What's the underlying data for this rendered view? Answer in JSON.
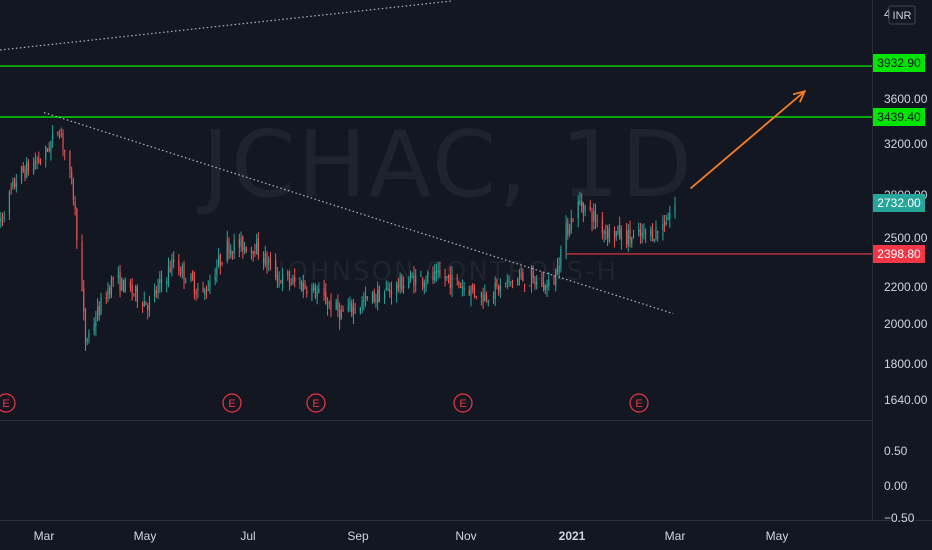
{
  "watermark": {
    "symbol": "JCHAC, 1D",
    "name": "JOHNSON CONTROLS-H"
  },
  "currency": "INR",
  "colors": {
    "background": "#131722",
    "up": "#26a69a",
    "down": "#ef5350",
    "green_line": "#00ff00",
    "red_line": "#f23645",
    "arrow": "#f57c27",
    "trend": "#b2b5be",
    "earnings": "#f23645"
  },
  "price_labels": [
    {
      "text": "3932.90",
      "value": 3932.9,
      "color": "#00e600"
    },
    {
      "text": "3439.40",
      "value": 3439.4,
      "color": "#00e600"
    },
    {
      "text": "2732.00",
      "value": 2732.0,
      "color": "#26a69a"
    },
    {
      "text": "2398.80",
      "value": 2398.8,
      "color": "#f23645"
    }
  ],
  "y_ticks": [
    "4",
    "3600.00",
    "3200.00",
    "2800.00",
    "2500.00",
    "2200.00",
    "2000.00",
    "1800.00",
    "1640.00"
  ],
  "indicator_ticks": [
    "0.50",
    "0.00",
    "−0.50"
  ],
  "x_ticks": [
    "Mar",
    "May",
    "Jul",
    "Sep",
    "Nov",
    "2021",
    "Mar",
    "May"
  ],
  "earnings_markers": [
    "E",
    "E",
    "E",
    "E",
    "E"
  ],
  "chart_data": {
    "type": "candlestick",
    "y_scale": "log",
    "ylim": [
      1640,
      4300
    ],
    "x_range": [
      "2020-02-01",
      "2021-06-15"
    ],
    "horizontal_lines": [
      {
        "value": 3932.9,
        "style": "solid",
        "color": "#00ff00"
      },
      {
        "value": 3439.4,
        "style": "solid",
        "color": "#00ff00"
      },
      {
        "value": 2398.8,
        "style": "solid",
        "color": "#f23645"
      }
    ],
    "trendlines": [
      {
        "from": [
          "2020-03-01",
          3480
        ],
        "to": [
          "2021-02-28",
          2050
        ],
        "style": "dotted"
      },
      {
        "from": [
          "2020-02-01",
          4150
        ],
        "to": [
          "2020-11-15",
          4300
        ],
        "style": "dotted"
      }
    ],
    "arrow": {
      "from": [
        "2021-03-10",
        2850
      ],
      "to": [
        "2021-05-15",
        3680
      ]
    },
    "last_close": 2732.0,
    "monthly_path": [
      [
        "2020-02-01",
        2500
      ],
      [
        "2020-02-15",
        2950
      ],
      [
        "2020-03-01",
        3100
      ],
      [
        "2020-03-10",
        3350
      ],
      [
        "2020-03-18",
        2800
      ],
      [
        "2020-03-25",
        1900
      ],
      [
        "2020-04-10",
        2250
      ],
      [
        "2020-05-01",
        2100
      ],
      [
        "2020-05-15",
        2350
      ],
      [
        "2020-06-01",
        2150
      ],
      [
        "2020-06-15",
        2450
      ],
      [
        "2020-07-01",
        2450
      ],
      [
        "2020-07-15",
        2250
      ],
      [
        "2020-08-01",
        2200
      ],
      [
        "2020-08-20",
        2050
      ],
      [
        "2020-09-10",
        2150
      ],
      [
        "2020-10-01",
        2250
      ],
      [
        "2020-10-20",
        2250
      ],
      [
        "2020-11-10",
        2150
      ],
      [
        "2020-12-01",
        2250
      ],
      [
        "2020-12-20",
        2200
      ],
      [
        "2020-12-28",
        2550
      ],
      [
        "2021-01-05",
        2750
      ],
      [
        "2021-01-20",
        2550
      ],
      [
        "2021-02-05",
        2500
      ],
      [
        "2021-02-20",
        2550
      ],
      [
        "2021-03-01",
        2732
      ]
    ]
  }
}
